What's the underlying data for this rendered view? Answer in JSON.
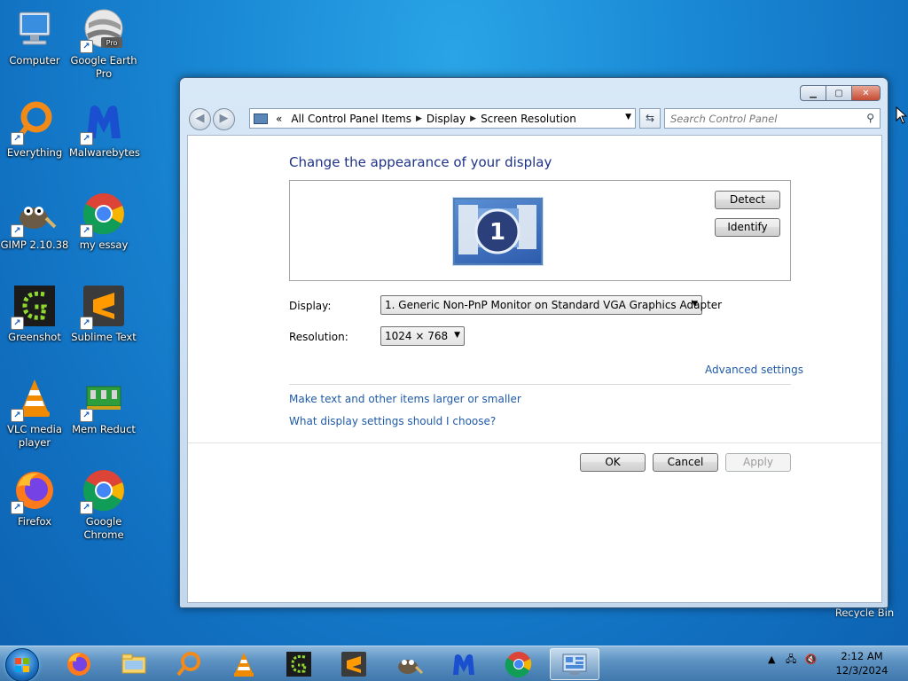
{
  "desktop": {
    "icons": [
      {
        "id": "computer",
        "label": "Computer"
      },
      {
        "id": "google-earth",
        "label": "Google Earth Pro"
      },
      {
        "id": "everything",
        "label": "Everything"
      },
      {
        "id": "malwarebytes",
        "label": "Malwarebytes"
      },
      {
        "id": "gimp",
        "label": "GIMP 2.10.38"
      },
      {
        "id": "my-essay",
        "label": "my essay"
      },
      {
        "id": "greenshot",
        "label": "Greenshot"
      },
      {
        "id": "sublime",
        "label": "Sublime Text"
      },
      {
        "id": "vlc",
        "label": "VLC media player"
      },
      {
        "id": "memreduct",
        "label": "Mem Reduct"
      },
      {
        "id": "firefox",
        "label": "Firefox"
      },
      {
        "id": "chrome",
        "label": "Google Chrome"
      }
    ],
    "recycle_bin_label": "Recycle Bin",
    "google_earth_badge": "Pro"
  },
  "window": {
    "caption_buttons": {
      "minimize": "▁",
      "maximize": "▢",
      "close": "✕"
    },
    "address": {
      "overflow": "«",
      "crumbs": [
        "All Control Panel Items",
        "Display",
        "Screen Resolution"
      ],
      "separator": "▶"
    },
    "search_placeholder": "Search Control Panel",
    "title": "Change the appearance of your display",
    "monitor_number": "1",
    "detect_button": "Detect",
    "identify_button": "Identify",
    "display_label": "Display:",
    "display_value": "1. Generic Non-PnP Monitor on Standard VGA Graphics Adapter",
    "resolution_label": "Resolution:",
    "resolution_value": "1024 × 768",
    "advanced_link": "Advanced settings",
    "link_text_size": "Make text and other items larger or smaller",
    "link_help": "What display settings should I choose?",
    "ok_button": "OK",
    "cancel_button": "Cancel",
    "apply_button": "Apply"
  },
  "taskbar": {
    "items": [
      "Firefox",
      "Windows Explorer",
      "Everything",
      "VLC media player",
      "Greenshot",
      "Sublime Text",
      "GIMP",
      "Malwarebytes",
      "Google Chrome",
      "Screen Resolution"
    ],
    "clock_time": "2:12 AM",
    "clock_date": "12/3/2024"
  },
  "colors": {
    "accent": "#1e3287",
    "link": "#1e5aa8",
    "desktop": "#1a8ad6"
  }
}
